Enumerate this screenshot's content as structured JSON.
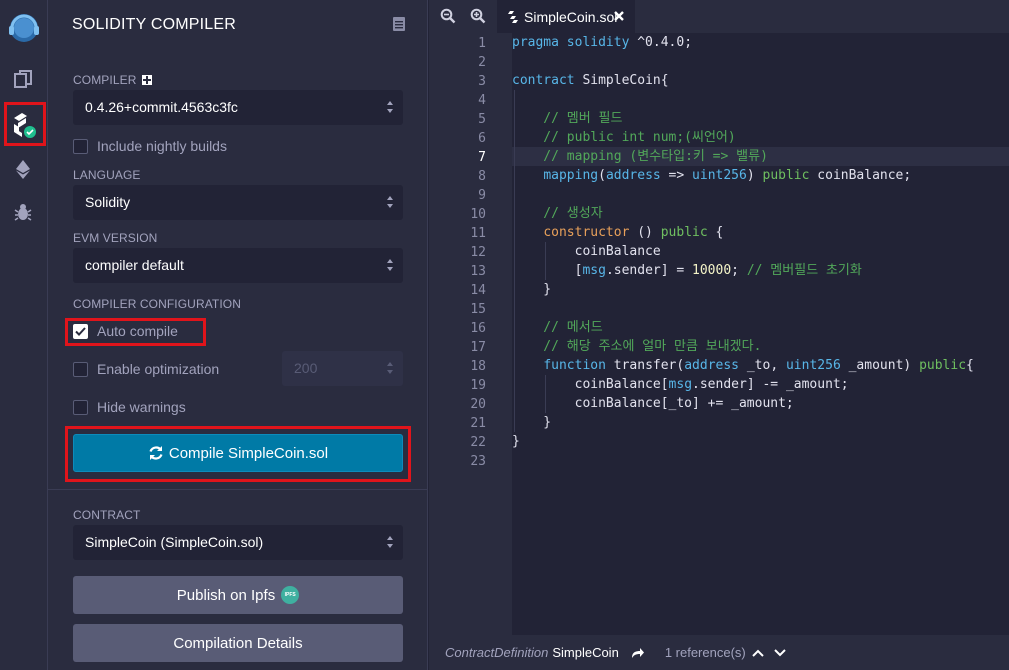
{
  "panel": {
    "title": "SOLIDITY COMPILER",
    "compiler_label": "COMPILER",
    "compiler_value": "0.4.26+commit.4563c3fc",
    "nightly_label": "Include nightly builds",
    "language_label": "LANGUAGE",
    "language_value": "Solidity",
    "evm_label": "EVM VERSION",
    "evm_value": "compiler default",
    "config_label": "COMPILER CONFIGURATION",
    "auto_compile_label": "Auto compile",
    "optimization_label": "Enable optimization",
    "optimization_runs": "200",
    "hide_warnings_label": "Hide warnings",
    "compile_button": "Compile SimpleCoin.sol",
    "contract_label": "CONTRACT",
    "contract_value": "SimpleCoin (SimpleCoin.sol)",
    "publish_button": "Publish on Ipfs",
    "ipfs_badge": "IPFS",
    "details_button": "Compilation Details"
  },
  "editor": {
    "tab_name": "SimpleCoin.sol",
    "line_numbers": [
      "1",
      "2",
      "3",
      "4",
      "5",
      "6",
      "7",
      "8",
      "9",
      "10",
      "11",
      "12",
      "13",
      "14",
      "15",
      "16",
      "17",
      "18",
      "19",
      "20",
      "21",
      "22",
      "23"
    ],
    "status": {
      "kind": "ContractDefinition",
      "name": "SimpleCoin",
      "references": "1 reference(s)"
    }
  },
  "colors": {
    "accent": "#007aa6",
    "highlight_box": "#e0141b",
    "success": "#1fbf8f"
  }
}
